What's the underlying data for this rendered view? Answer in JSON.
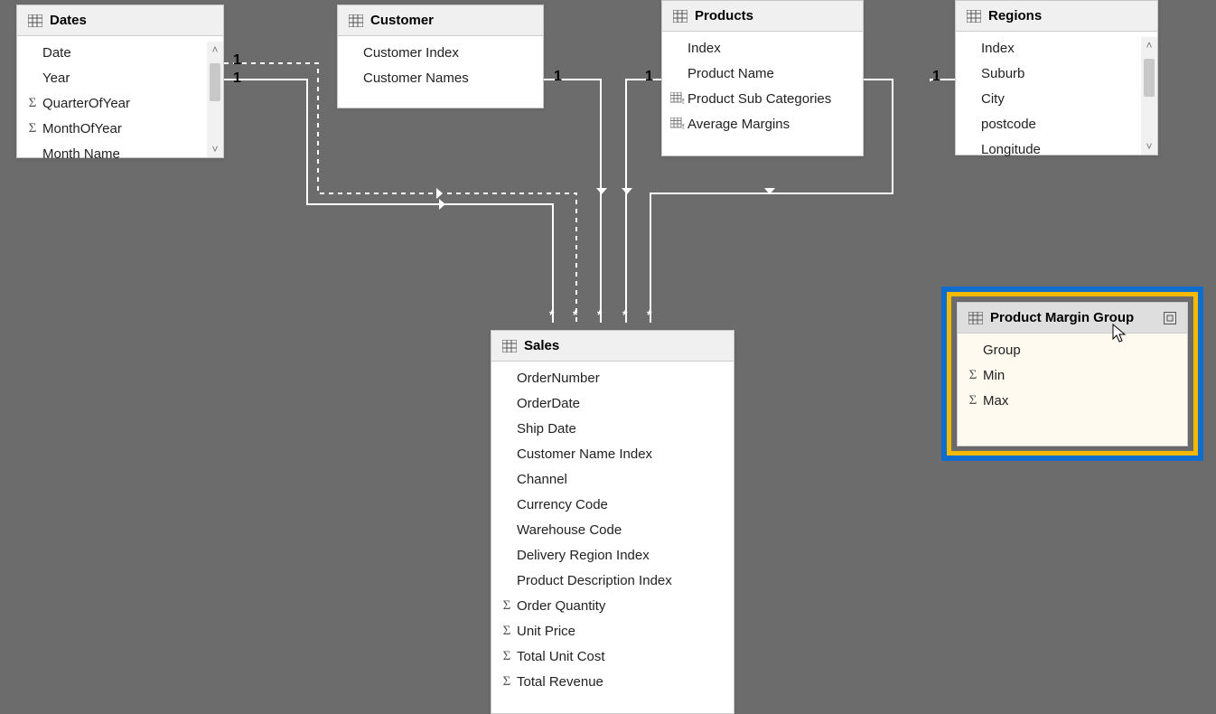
{
  "tables": {
    "dates": {
      "title": "Dates",
      "fields": [
        "Date",
        "Year",
        "QuarterOfYear",
        "MonthOfYear",
        "Month Name"
      ],
      "fieldIcons": [
        "",
        "",
        "sigma",
        "sigma",
        ""
      ],
      "hasScroll": true
    },
    "customer": {
      "title": "Customer",
      "fields": [
        "Customer Index",
        "Customer Names"
      ],
      "fieldIcons": [
        "",
        ""
      ],
      "hasScroll": false
    },
    "products": {
      "title": "Products",
      "fields": [
        "Index",
        "Product Name",
        "Product Sub Categories",
        "Average Margins"
      ],
      "fieldIcons": [
        "",
        "",
        "calc",
        "calc"
      ],
      "hasScroll": false
    },
    "regions": {
      "title": "Regions",
      "fields": [
        "Index",
        "Suburb",
        "City",
        "postcode",
        "Longitude"
      ],
      "fieldIcons": [
        "",
        "",
        "",
        "",
        ""
      ],
      "hasScroll": true
    },
    "sales": {
      "title": "Sales",
      "fields": [
        "OrderNumber",
        "OrderDate",
        "Ship Date",
        "Customer Name Index",
        "Channel",
        "Currency Code",
        "Warehouse Code",
        "Delivery Region Index",
        "Product Description Index",
        "Order Quantity",
        "Unit Price",
        "Total Unit Cost",
        "Total Revenue"
      ],
      "fieldIcons": [
        "",
        "",
        "",
        "",
        "",
        "",
        "",
        "",
        "",
        "sigma",
        "sigma",
        "sigma",
        "sigma"
      ],
      "hasScroll": false
    },
    "pmg": {
      "title": "Product Margin Group",
      "fields": [
        "Group",
        "Min",
        "Max"
      ],
      "fieldIcons": [
        "",
        "sigma",
        "sigma"
      ],
      "hasScroll": false
    }
  },
  "cardinality": {
    "dates_one_a": "1",
    "dates_one_b": "1",
    "customer_one": "1",
    "products_one": "1",
    "regions_one": "1",
    "many": "*"
  }
}
